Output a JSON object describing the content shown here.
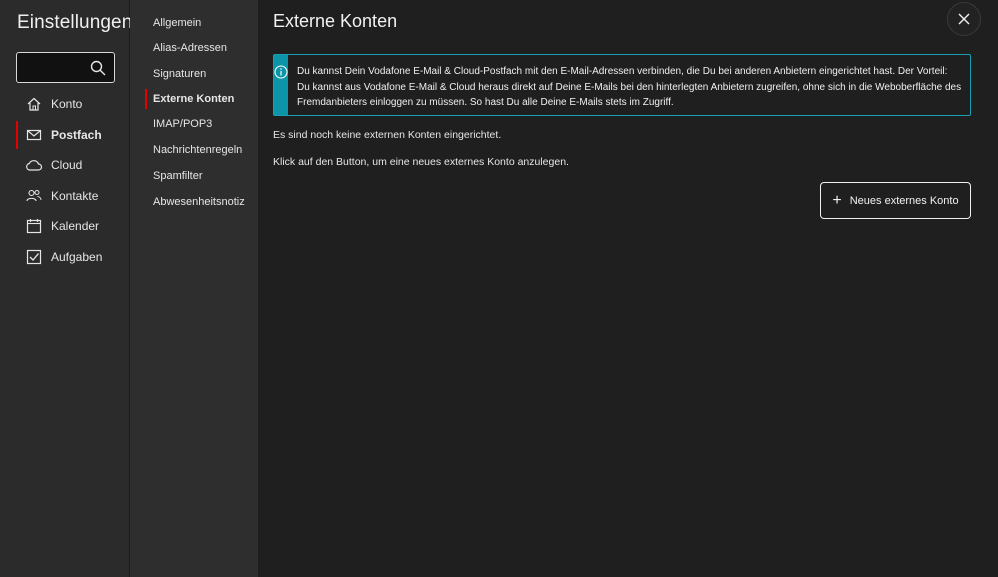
{
  "settings": {
    "title": "Einstellungen",
    "search": {
      "value": "",
      "placeholder": ""
    },
    "main_nav": [
      {
        "label": "Konto",
        "icon": "home-icon"
      },
      {
        "label": "Postfach",
        "icon": "mail-icon",
        "active": true
      },
      {
        "label": "Cloud",
        "icon": "cloud-icon"
      },
      {
        "label": "Kontakte",
        "icon": "contacts-icon"
      },
      {
        "label": "Kalender",
        "icon": "calendar-icon"
      },
      {
        "label": "Aufgaben",
        "icon": "tasks-icon"
      }
    ],
    "sub_nav": [
      {
        "label": "Allgemein"
      },
      {
        "label": "Alias-Adressen"
      },
      {
        "label": "Signaturen"
      },
      {
        "label": "Externe Konten",
        "active": true
      },
      {
        "label": "IMAP/POP3"
      },
      {
        "label": "Nachrichtenregeln"
      },
      {
        "label": "Spamfilter"
      },
      {
        "label": "Abwesenheitsnotiz"
      }
    ]
  },
  "page": {
    "title": "Externe Konten",
    "info_text": "Du kannst Dein Vodafone E-Mail & Cloud-Postfach mit den E-Mail-Adressen verbinden, die Du bei anderen Anbietern eingerichtet hast. Der Vorteil: Du kannst aus Vodafone E-Mail & Cloud heraus direkt auf Deine E-Mails bei den hinterlegten Anbietern zugreifen, ohne sich in die Weboberfläche des Fremdanbieters einloggen zu müssen. So hast Du alle Deine E-Mails stets im Zugriff.",
    "empty_text": "Es sind noch keine externen Konten eingerichtet.",
    "hint_text": "Klick auf den Button, um eine neues externes Konto anzulegen.",
    "new_button_label": "Neues externes Konto"
  },
  "colors": {
    "accent": "#e60000",
    "info": "#0c95a8",
    "background": "#1f1f1f"
  }
}
